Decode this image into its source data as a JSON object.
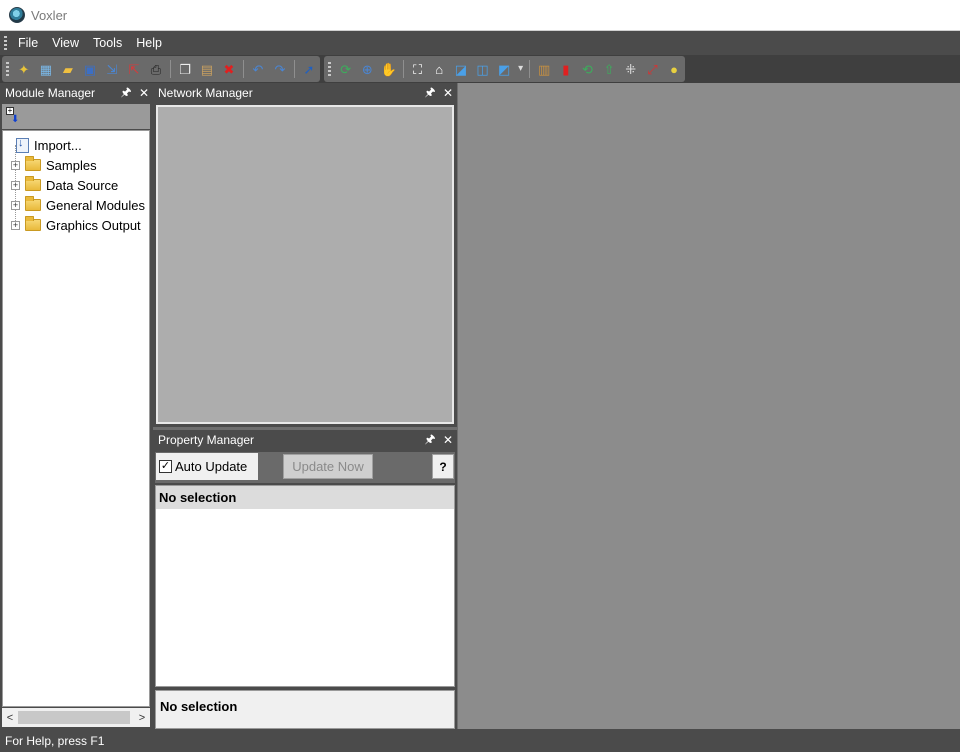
{
  "window": {
    "title": "Voxler"
  },
  "menu": [
    "File",
    "View",
    "Tools",
    "Help"
  ],
  "toolbar1": [
    {
      "icon": "new-icon",
      "glyph": "✦",
      "color": "#e8c43a"
    },
    {
      "icon": "new-network-icon",
      "glyph": "▦",
      "color": "#7ab8e8"
    },
    {
      "icon": "open-icon",
      "glyph": "▰",
      "color": "#f0c040"
    },
    {
      "icon": "save-icon",
      "glyph": "▣",
      "color": "#3c6fc4"
    },
    {
      "icon": "import-icon",
      "glyph": "⇲",
      "color": "#4a86d4"
    },
    {
      "icon": "export-icon",
      "glyph": "⇱",
      "color": "#d43c3c"
    },
    {
      "icon": "print-icon",
      "glyph": "⎙",
      "color": "#222222"
    },
    {
      "icon": "separator"
    },
    {
      "icon": "copy-icon",
      "glyph": "❐",
      "color": "#eeeeee"
    },
    {
      "icon": "paste-icon",
      "glyph": "▤",
      "color": "#c8a060"
    },
    {
      "icon": "delete-icon",
      "glyph": "✖",
      "color": "#e02020"
    },
    {
      "icon": "separator"
    },
    {
      "icon": "undo-icon",
      "glyph": "↶",
      "color": "#4a86d4"
    },
    {
      "icon": "redo-icon",
      "glyph": "↷",
      "color": "#4a86d4"
    },
    {
      "icon": "separator"
    },
    {
      "icon": "context-help-icon",
      "glyph": "➚",
      "color": "#2060c0"
    }
  ],
  "toolbar2": [
    {
      "icon": "rotate-icon",
      "glyph": "⟳",
      "color": "#3cae5c"
    },
    {
      "icon": "zoom-icon",
      "glyph": "⊕",
      "color": "#4a86d4"
    },
    {
      "icon": "pan-icon",
      "glyph": "✋",
      "color": "#e0b060"
    },
    {
      "icon": "separator"
    },
    {
      "icon": "fit-to-window-icon",
      "glyph": "⛶",
      "color": "#ffffff"
    },
    {
      "icon": "home-icon",
      "glyph": "⌂",
      "color": "#ffffff"
    },
    {
      "icon": "view-perspective-icon",
      "glyph": "◪",
      "color": "#4aa0e8"
    },
    {
      "icon": "view-cube-icon",
      "glyph": "◫",
      "color": "#4aa0e8"
    },
    {
      "icon": "view-options-icon",
      "glyph": "◩",
      "color": "#4aa0e8"
    },
    {
      "icon": "dropdown-arrow-icon",
      "glyph": "▾",
      "color": "#dddddd"
    },
    {
      "icon": "separator"
    },
    {
      "icon": "capture-icon",
      "glyph": "▥",
      "color": "#c89040"
    },
    {
      "icon": "record-icon",
      "glyph": "▮",
      "color": "#e02020"
    },
    {
      "icon": "update-view-icon",
      "glyph": "⟲",
      "color": "#3cae5c"
    },
    {
      "icon": "module-up-icon",
      "glyph": "⇧",
      "color": "#3cae5c"
    },
    {
      "icon": "axes-icon",
      "glyph": "⁜",
      "color": "#dddddd"
    },
    {
      "icon": "graph-axes-icon",
      "glyph": "⤢",
      "color": "#dd3030"
    },
    {
      "icon": "light-icon",
      "glyph": "●",
      "color": "#e8d040"
    }
  ],
  "module_manager": {
    "title": "Module Manager",
    "items": [
      {
        "label": "Import...",
        "kind": "import"
      },
      {
        "label": "Samples",
        "kind": "folder"
      },
      {
        "label": "Data Source",
        "kind": "folder"
      },
      {
        "label": "General Modules",
        "kind": "folder"
      },
      {
        "label": "Graphics Output",
        "kind": "folder"
      }
    ]
  },
  "network_manager": {
    "title": "Network Manager"
  },
  "property_manager": {
    "title": "Property Manager",
    "auto_update_label": "Auto Update",
    "auto_update_checked": true,
    "update_now_label": "Update Now",
    "help_label": "?",
    "grid_header": "No selection",
    "description": "No selection"
  },
  "status": {
    "text": "For Help, press F1"
  },
  "panel_buttons": {
    "pin": "🖈",
    "close": "✕"
  }
}
